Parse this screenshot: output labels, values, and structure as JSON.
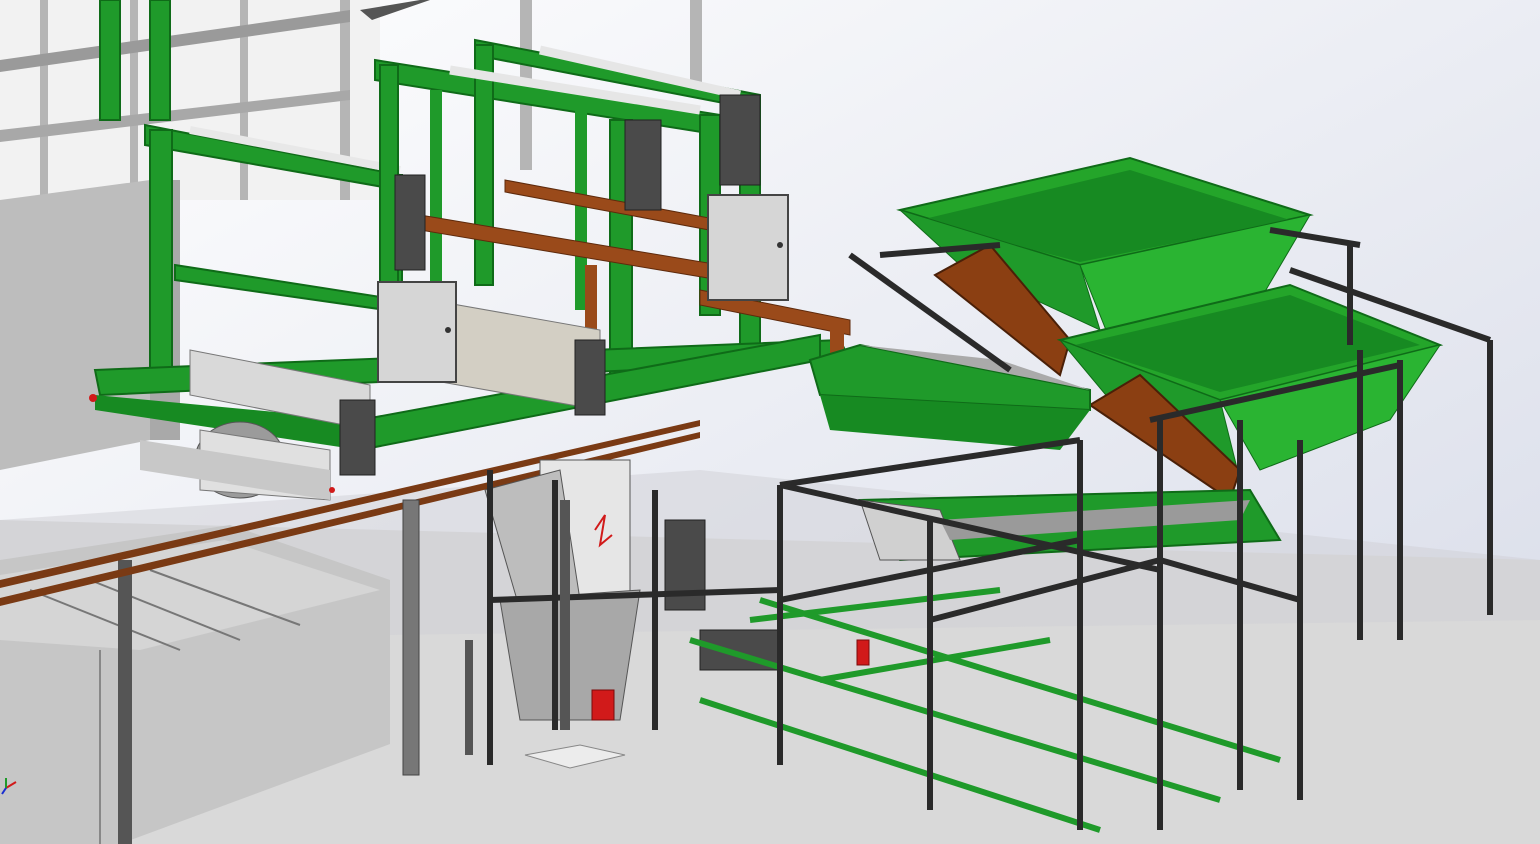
{
  "scene": {
    "background_top": "#ffffff",
    "background_bottom": "#d7dbe8",
    "floor_color": "#d9d9d9",
    "frame_green": "#1f9a2a",
    "frame_green_dark": "#0f6b18",
    "hopper_green": "#24a52a",
    "rust_brown": "#9a4a1a",
    "steel_gray": "#c9c9c9",
    "dark_frame": "#2a2a2a",
    "motor_gray": "#4a4a4a",
    "red_part": "#d11a1a",
    "triad_colors": [
      "#d11a1a",
      "#1a2fd0",
      "#1f9a2a"
    ]
  },
  "components": [
    "portal-frame-left",
    "portal-frame-right",
    "gear-motor",
    "control-cabinet",
    "hopper-upper",
    "hopper-lower",
    "inclined-conveyor",
    "safety-fence",
    "process-tank",
    "red-pedestal"
  ],
  "triad": {
    "x_label": "",
    "y_label": "",
    "z_label": ""
  }
}
